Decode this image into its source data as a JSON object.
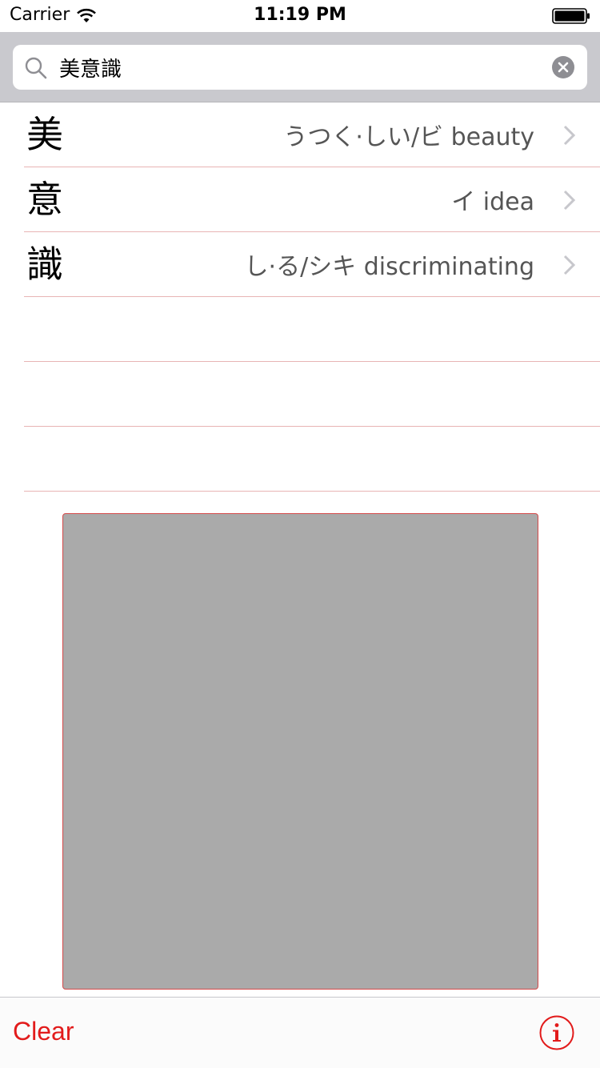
{
  "status_bar": {
    "carrier": "Carrier",
    "time": "11:19 PM",
    "wifi_icon": "wifi-icon",
    "battery_icon": "battery-icon"
  },
  "search": {
    "value": "美意識",
    "icon": "search-icon",
    "clear_icon": "clear-icon"
  },
  "results": [
    {
      "kanji": "美",
      "reading": "うつく·しい/ビ beauty"
    },
    {
      "kanji": "意",
      "reading": "イ idea"
    },
    {
      "kanji": "識",
      "reading": "し·る/シキ discriminating"
    }
  ],
  "toolbar": {
    "clear_label": "Clear",
    "info_icon": "info-icon"
  },
  "colors": {
    "accent": "#e21b1b",
    "separator": "#e8b4b4",
    "canvas": "#aaaaaa",
    "search_bar_bg": "#c9c9ce"
  }
}
